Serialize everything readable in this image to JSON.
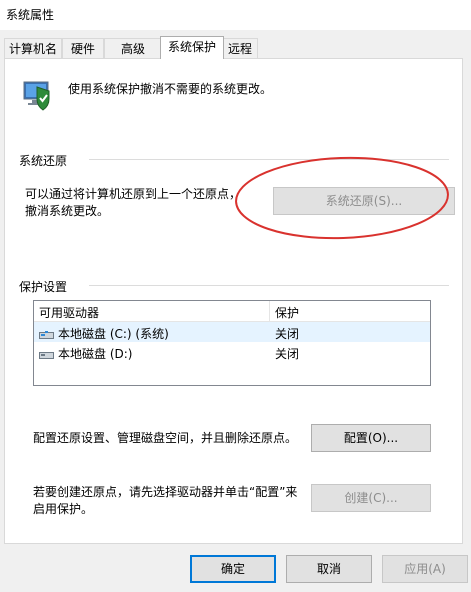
{
  "window": {
    "title": "系统属性"
  },
  "tabs": [
    {
      "label": "计算机名"
    },
    {
      "label": "硬件"
    },
    {
      "label": "高级"
    },
    {
      "label": "系统保护"
    },
    {
      "label": "远程"
    }
  ],
  "header": {
    "description": "使用系统保护撤消不需要的系统更改。"
  },
  "restore": {
    "group_label": "系统还原",
    "text": "可以通过将计算机还原到上一个还原点，撤消系统更改。",
    "button_label": "系统还原(S)..."
  },
  "protection": {
    "group_label": "保护设置",
    "columns": [
      "可用驱动器",
      "保护"
    ],
    "rows": [
      {
        "drive": "本地磁盘 (C:) (系统)",
        "status": "关闭"
      },
      {
        "drive": "本地磁盘 (D:)",
        "status": "关闭"
      }
    ],
    "configure_text": "配置还原设置、管理磁盘空间，并且删除还原点。",
    "configure_button": "配置(O)...",
    "create_text": "若要创建还原点，请先选择驱动器并单击“配置”来启用保护。",
    "create_button": "创建(C)..."
  },
  "footer": {
    "ok": "确定",
    "cancel": "取消",
    "apply": "应用(A)"
  }
}
